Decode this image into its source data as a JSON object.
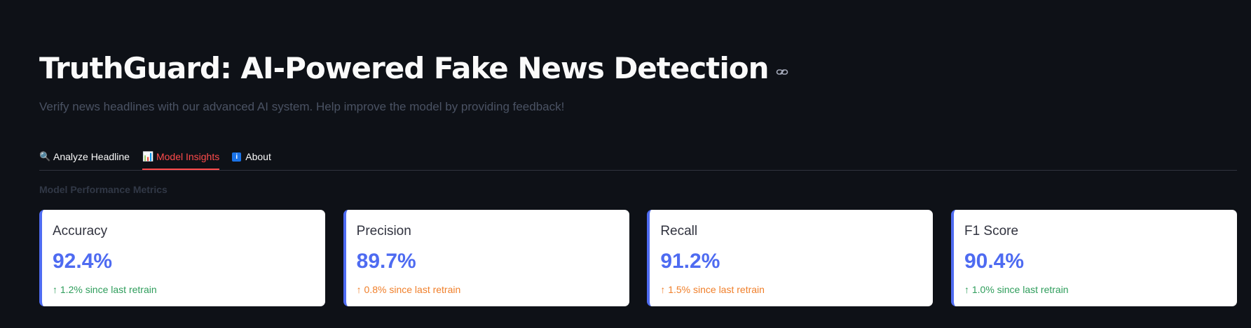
{
  "header": {
    "title": "TruthGuard: AI-Powered Fake News Detection",
    "subtitle": "Verify news headlines with our advanced AI system. Help improve the model by providing feedback!"
  },
  "tabs": [
    {
      "icon": "🔍",
      "label": "Analyze Headline",
      "active": false
    },
    {
      "icon": "📊",
      "label": "Model Insights",
      "active": true
    },
    {
      "icon": "i",
      "label": "About",
      "active": false
    }
  ],
  "section": {
    "label": "Model Performance Metrics"
  },
  "metrics": [
    {
      "label": "Accuracy",
      "value": "92.4%",
      "delta": "↑ 1.2% since last retrain",
      "delta_color": "green"
    },
    {
      "label": "Precision",
      "value": "89.7%",
      "delta": "↑ 0.8% since last retrain",
      "delta_color": "orange"
    },
    {
      "label": "Recall",
      "value": "91.2%",
      "delta": "↑ 1.5% since last retrain",
      "delta_color": "orange"
    },
    {
      "label": "F1 Score",
      "value": "90.4%",
      "delta": "↑ 1.0% since last retrain",
      "delta_color": "green"
    }
  ],
  "colors": {
    "background": "#0e1117",
    "accent": "#4e6bf1",
    "active_tab": "#ff4b4b",
    "delta_green": "#2e9d5b",
    "delta_orange": "#f07f2a"
  },
  "icons": {
    "anchor": "link-icon",
    "tab_0": "magnifier-icon",
    "tab_1": "bar-chart-icon",
    "tab_2": "info-icon"
  }
}
